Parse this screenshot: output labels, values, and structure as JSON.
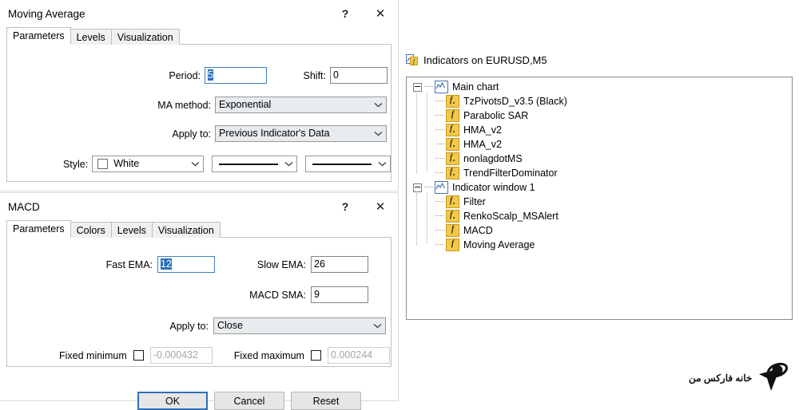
{
  "moving_average_dialog": {
    "title": "Moving Average",
    "titlebar_buttons": [
      {
        "name": "help-button",
        "glyph": "?"
      },
      {
        "name": "close-button",
        "glyph": "✕"
      }
    ],
    "tabs": [
      {
        "label": "Parameters",
        "active": true
      },
      {
        "label": "Levels",
        "active": false
      },
      {
        "label": "Visualization",
        "active": false
      }
    ],
    "fields": {
      "period_label": "Period:",
      "period_value": "5",
      "shift_label": "Shift:",
      "shift_value": "0",
      "ma_method_label": "MA method:",
      "ma_method_value": "Exponential",
      "apply_to_label": "Apply to:",
      "apply_to_value": "Previous Indicator's Data",
      "style_label": "Style:",
      "style_color_value": "White",
      "style_color_hex": "#ffffff",
      "style_width_value": "line",
      "style_type_value": "line"
    }
  },
  "macd_dialog": {
    "title": "MACD",
    "titlebar_buttons": [
      {
        "name": "help-button",
        "glyph": "?"
      },
      {
        "name": "close-button",
        "glyph": "✕"
      }
    ],
    "tabs": [
      {
        "label": "Parameters",
        "active": true
      },
      {
        "label": "Colors",
        "active": false
      },
      {
        "label": "Levels",
        "active": false
      },
      {
        "label": "Visualization",
        "active": false
      }
    ],
    "fields": {
      "fast_ema_label": "Fast EMA:",
      "fast_ema_value": "12",
      "slow_ema_label": "Slow EMA:",
      "slow_ema_value": "26",
      "macd_sma_label": "MACD SMA:",
      "macd_sma_value": "9",
      "apply_to_label": "Apply to:",
      "apply_to_value": "Close",
      "fixed_minimum_label": "Fixed minimum",
      "fixed_minimum_checked": false,
      "fixed_minimum_value": "-0.000432",
      "fixed_maximum_label": "Fixed maximum",
      "fixed_maximum_checked": false,
      "fixed_maximum_value": "0.000244"
    },
    "buttons": [
      {
        "label": "OK",
        "primary": true
      },
      {
        "label": "Cancel",
        "primary": false
      },
      {
        "label": "Reset",
        "primary": false
      }
    ]
  },
  "indicators_panel": {
    "header": "Indicators on EURUSD,M5",
    "header_icon": "indicators-icon",
    "tree": [
      {
        "label": "Main chart",
        "icon": "chart-window-icon",
        "expanded": true,
        "children": [
          {
            "label": "TzPivotsD_v3.5 (Black)",
            "icon": "custom-indicator-icon"
          },
          {
            "label": "Parabolic SAR",
            "icon": "builtin-indicator-icon"
          },
          {
            "label": "HMA_v2",
            "icon": "custom-indicator-icon"
          },
          {
            "label": "HMA_v2",
            "icon": "custom-indicator-icon"
          },
          {
            "label": "nonlagdotMS",
            "icon": "custom-indicator-icon"
          },
          {
            "label": "TrendFilterDominator",
            "icon": "custom-indicator-icon"
          }
        ]
      },
      {
        "label": "Indicator window 1",
        "icon": "chart-window-icon",
        "expanded": true,
        "children": [
          {
            "label": "Filter",
            "icon": "custom-indicator-icon"
          },
          {
            "label": "RenkoScalp_MSAlert",
            "icon": "custom-indicator-icon"
          },
          {
            "label": "MACD",
            "icon": "builtin-indicator-icon"
          },
          {
            "label": "Moving Average",
            "icon": "builtin-indicator-icon"
          }
        ]
      }
    ]
  },
  "watermarks": {
    "text": "خانه فارکس من",
    "logo_text": "خانه فارکس من"
  },
  "colors": {
    "accent": "#2f6fb5",
    "selection": "#2a6fb4",
    "icon_yellow": "#f2c94c",
    "icon_blue": "#4a72b8",
    "watermark_gray": "#e4e4e4"
  }
}
